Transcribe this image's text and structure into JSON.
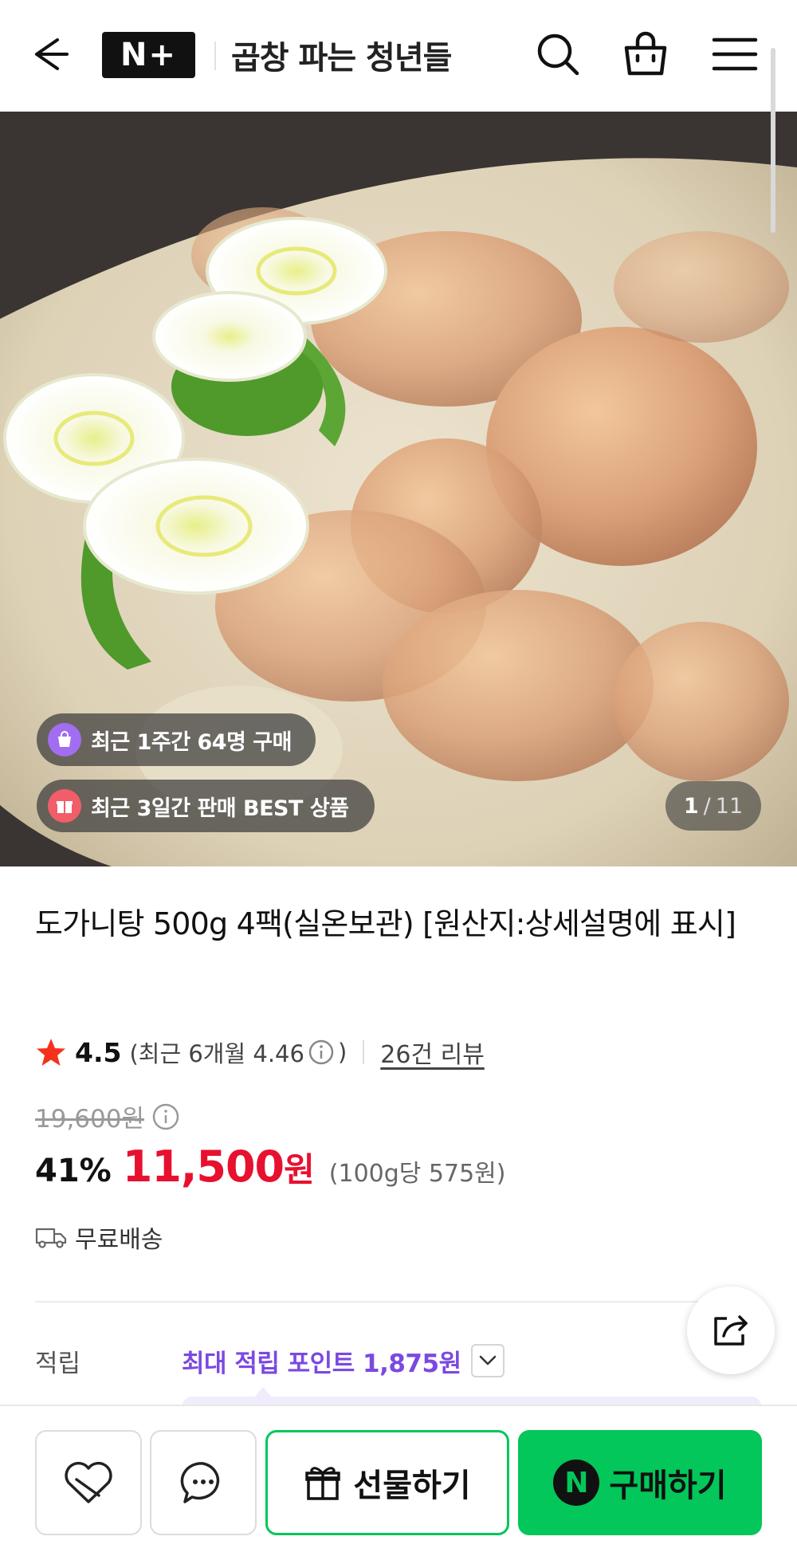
{
  "header": {
    "logo_text": "N+",
    "store_name": "곱창 파는 청년들"
  },
  "hero": {
    "badge1_text": "최근 1주간 64명 구매",
    "badge2_text": "최근 3일간 판매 BEST 상품",
    "page_current": "1",
    "page_separator": "/",
    "page_total": "11"
  },
  "product": {
    "title": "도가니탕 500g 4팩(실온보관) [원산지:상세설명에 표시]",
    "rating": "4.5",
    "rating_recent_prefix": "(최근 6개월 4.46",
    "rating_recent_suffix": ")",
    "review_link": "26건 리뷰",
    "original_price": "19,600원",
    "discount": "41%",
    "sale_price": "11,500",
    "sale_currency": "원",
    "unit_price": "(100g당 575원)",
    "shipping": "무료배송"
  },
  "points": {
    "label": "적립",
    "value": "최대 적립 포인트 1,875원"
  },
  "bottom_bar": {
    "gift_label": "선물하기",
    "buy_label": "구매하기",
    "npay_letter": "N"
  },
  "colors": {
    "sale_red": "#e8102f",
    "naver_green": "#03c75a",
    "points_purple": "#7b49e0"
  }
}
